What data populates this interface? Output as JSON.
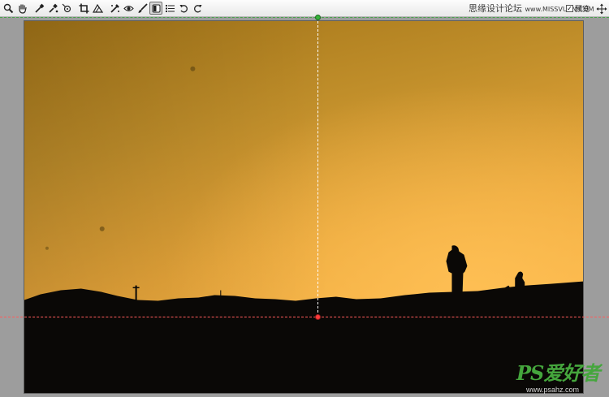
{
  "toolbar": {
    "tools": [
      {
        "name": "zoom-tool",
        "icon": "magnifier-icon"
      },
      {
        "name": "hand-tool",
        "icon": "hand-icon"
      },
      {
        "name": "white-balance-tool",
        "icon": "eyedropper-icon"
      },
      {
        "name": "color-sampler-tool",
        "icon": "color-sampler-icon"
      },
      {
        "name": "target-adjustment-tool",
        "icon": "target-icon"
      },
      {
        "name": "crop-tool",
        "icon": "crop-icon"
      },
      {
        "name": "straighten-tool",
        "icon": "straighten-icon"
      },
      {
        "name": "spot-removal-tool",
        "icon": "spot-brush-icon"
      },
      {
        "name": "red-eye-tool",
        "icon": "red-eye-icon"
      },
      {
        "name": "adjustment-brush-tool",
        "icon": "brush-icon"
      },
      {
        "name": "graduated-filter-tool",
        "icon": "graduated-filter-icon"
      },
      {
        "name": "preferences",
        "icon": "list-icon"
      },
      {
        "name": "rotate-left",
        "icon": "rotate-ccw-icon"
      },
      {
        "name": "rotate-right",
        "icon": "rotate-cw-icon"
      }
    ],
    "watermark_text": "思缘设计论坛",
    "watermark_url": "www.MISSVUAN.COM",
    "preview_label": "预览",
    "preview_checked": true
  },
  "colors": {
    "guide_green": "#48a24a",
    "guide_red": "#ff5b5b",
    "sky_top": "#a87a1f",
    "sky_bottom": "#ffb84a",
    "ground": "#090705"
  },
  "watermark": {
    "logo": "PS爱好者",
    "url": "www.psahz.com"
  }
}
